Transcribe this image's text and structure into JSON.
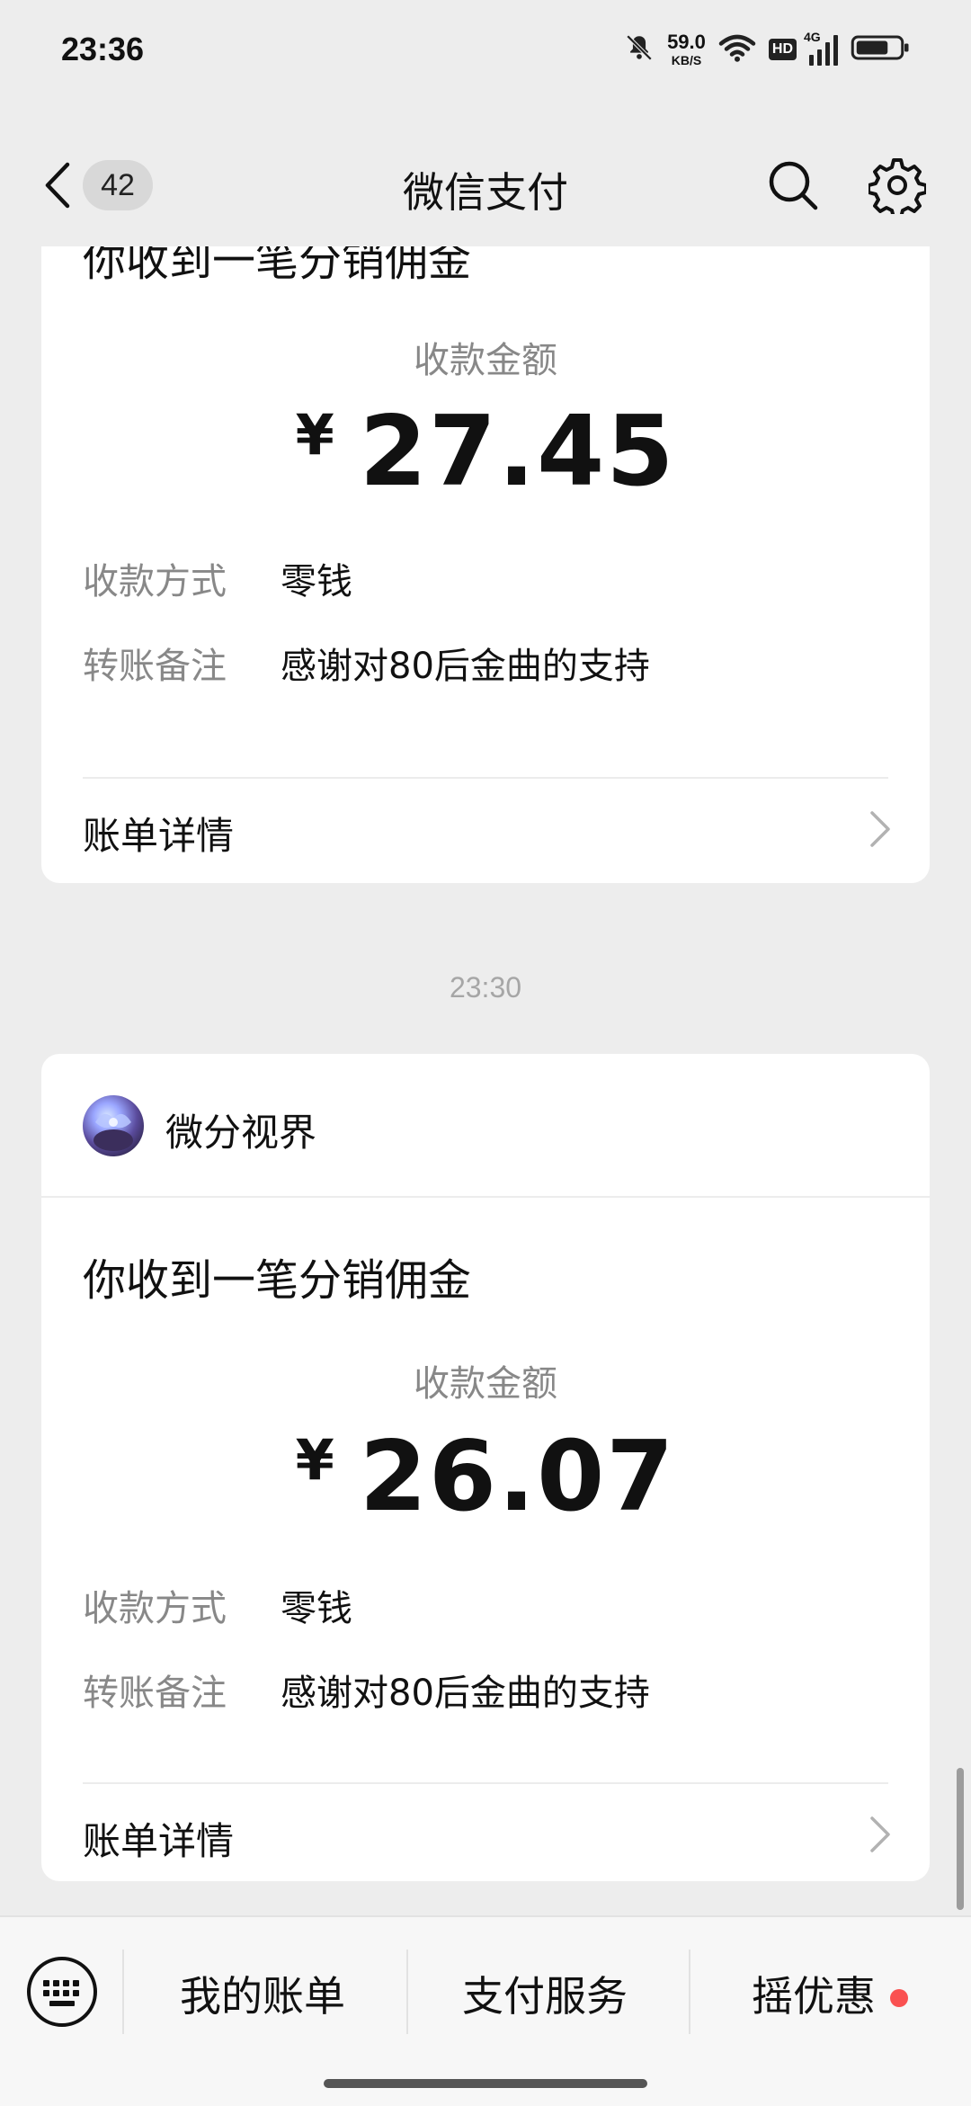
{
  "status_bar": {
    "time": "23:36",
    "net_speed_value": "59.0",
    "net_speed_unit": "KB/S",
    "hd_label": "HD",
    "network_label": "4G",
    "icons": [
      "mute-bell-icon",
      "wifi-icon",
      "hd-icon",
      "signal-icon",
      "battery-icon"
    ]
  },
  "nav": {
    "unread_count": "42",
    "title": "微信支付",
    "icons": [
      "back-chevron-icon",
      "search-icon",
      "gear-icon"
    ]
  },
  "messages": [
    {
      "title": "你收到一笔分销佣金",
      "amount_label": "收款金额",
      "currency": "¥",
      "amount": "27.45",
      "rows": [
        {
          "label": "收款方式",
          "value": "零钱"
        },
        {
          "label": "转账备注",
          "value": "感谢对80后金曲的支持"
        }
      ],
      "detail_label": "账单详情"
    },
    {
      "time": "23:30",
      "merchant": "微分视界",
      "title": "你收到一笔分销佣金",
      "amount_label": "收款金额",
      "currency": "¥",
      "amount": "26.07",
      "rows": [
        {
          "label": "收款方式",
          "value": "零钱"
        },
        {
          "label": "转账备注",
          "value": "感谢对80后金曲的支持"
        }
      ],
      "detail_label": "账单详情"
    }
  ],
  "bottom_bar": {
    "tabs": [
      "我的账单",
      "支付服务",
      "摇优惠"
    ],
    "has_badge_on_last": true
  },
  "colors": {
    "background": "#ededed",
    "card": "#ffffff",
    "secondary_text": "#888888",
    "badge_red": "#fa5151"
  }
}
